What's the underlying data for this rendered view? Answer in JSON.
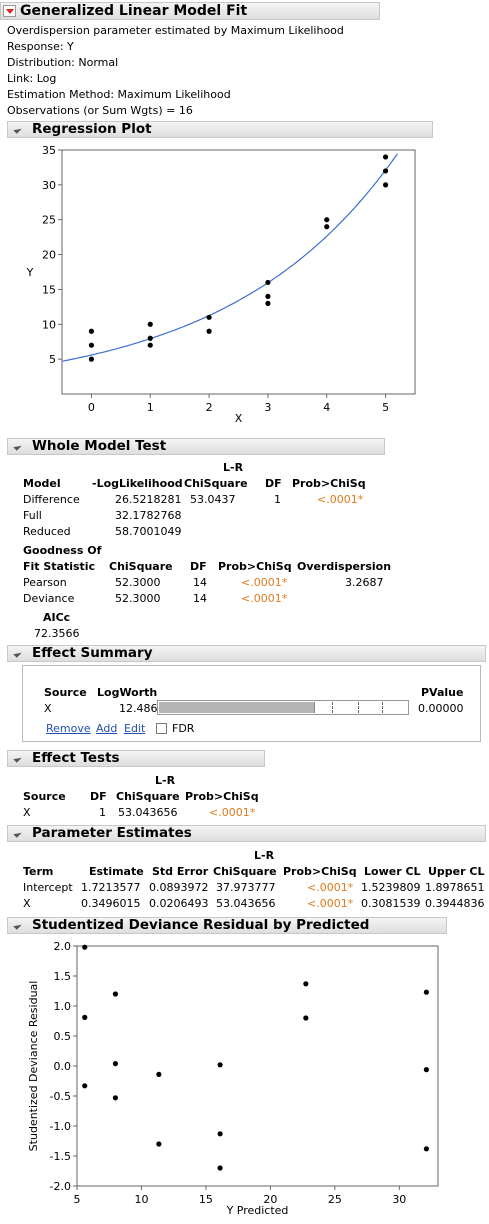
{
  "report": {
    "title": "Generalized Linear Model Fit",
    "info": [
      "Overdispersion parameter estimated by Maximum Likelihood",
      "Response: Y",
      "Distribution: Normal",
      "Link: Log",
      "Estimation Method: Maximum Likelihood",
      "Observations (or Sum Wgts) = 16"
    ]
  },
  "regression_plot": {
    "title": "Regression Plot",
    "chart_data": {
      "type": "scatter",
      "xlabel": "X",
      "ylabel": "Y",
      "xlim": [
        -0.5,
        5.5
      ],
      "ylim": [
        0,
        35
      ],
      "xticks": [
        "0",
        "1",
        "2",
        "3",
        "4",
        "5"
      ],
      "yticks": [
        "5",
        "10",
        "15",
        "20",
        "25",
        "30",
        "35"
      ],
      "points": [
        [
          0,
          5
        ],
        [
          0,
          7
        ],
        [
          0,
          9
        ],
        [
          1,
          7
        ],
        [
          1,
          8
        ],
        [
          1,
          10
        ],
        [
          2,
          9
        ],
        [
          2,
          11
        ],
        [
          3,
          13
        ],
        [
          3,
          14
        ],
        [
          3,
          16
        ],
        [
          4,
          24
        ],
        [
          4,
          25
        ],
        [
          5,
          30
        ],
        [
          5,
          32
        ],
        [
          5,
          34
        ]
      ],
      "fit_curve": {
        "intercept": 1.7213577,
        "slope": 0.3496015,
        "link": "log"
      },
      "colors": {
        "points": "#000000",
        "curve": "#3b6fd4"
      }
    }
  },
  "whole_model_test": {
    "title": "Whole Model Test",
    "headers": [
      "Model",
      "-LogLikelihood",
      "L-R",
      "ChiSquare",
      "DF",
      "Prob>ChiSq"
    ],
    "rows": [
      {
        "model": "Difference",
        "loglik": "26.5218281",
        "chisq": "53.0437",
        "df": "1",
        "prob": "<.0001*"
      },
      {
        "model": "Full",
        "loglik": "32.1782768"
      },
      {
        "model": "Reduced",
        "loglik": "58.7001049"
      }
    ],
    "gof_headers": [
      "Goodness Of",
      "Fit Statistic",
      "ChiSquare",
      "DF",
      "Prob>ChiSq",
      "Overdispersion"
    ],
    "gof_rows": [
      {
        "stat": "Pearson",
        "chisq": "52.3000",
        "df": "14",
        "prob": "<.0001*",
        "over": "3.2687"
      },
      {
        "stat": "Deviance",
        "chisq": "52.3000",
        "df": "14",
        "prob": "<.0001*"
      }
    ],
    "aicc_label": "AICc",
    "aicc_value": "72.3566"
  },
  "effect_summary": {
    "title": "Effect Summary",
    "headers": {
      "source": "Source",
      "logworth": "LogWorth",
      "pvalue": "PValue"
    },
    "row": {
      "source": "X",
      "logworth": "12.486",
      "pvalue": "0.00000",
      "bar_fraction": 0.62
    },
    "buttons": {
      "remove": "Remove",
      "add": "Add",
      "edit": "Edit"
    },
    "fdr_label": "FDR"
  },
  "effect_tests": {
    "title": "Effect Tests",
    "headers": [
      "Source",
      "DF",
      "L-R",
      "ChiSquare",
      "Prob>ChiSq"
    ],
    "row": {
      "source": "X",
      "df": "1",
      "chisq": "53.043656",
      "prob": "<.0001*"
    }
  },
  "parameter_estimates": {
    "title": "Parameter Estimates",
    "headers": [
      "Term",
      "Estimate",
      "Std Error",
      "L-R",
      "ChiSquare",
      "Prob>ChiSq",
      "Lower CL",
      "Upper CL"
    ],
    "rows": [
      {
        "term": "Intercept",
        "est": "1.7213577",
        "se": "0.0893972",
        "chisq": "37.973777",
        "prob": "<.0001*",
        "lcl": "1.5239809",
        "ucl": "1.8978651"
      },
      {
        "term": "X",
        "est": "0.3496015",
        "se": "0.0206493",
        "chisq": "53.043656",
        "prob": "<.0001*",
        "lcl": "0.3081539",
        "ucl": "0.3944836"
      }
    ]
  },
  "residual_plot": {
    "title": "Studentized Deviance Residual by Predicted",
    "chart_data": {
      "type": "scatter",
      "xlabel": "Y Predicted",
      "ylabel": "Studentized Deviance Residual",
      "xlim": [
        5,
        33
      ],
      "ylim": [
        -2.0,
        2.0
      ],
      "xticks": [
        "5",
        "10",
        "15",
        "20",
        "25",
        "30"
      ],
      "yticks": [
        "-2.0",
        "-1.5",
        "-1.0",
        "-0.5",
        "0.0",
        "0.5",
        "1.0",
        "1.5",
        "2.0"
      ],
      "points": [
        [
          5.6,
          1.98
        ],
        [
          5.6,
          0.81
        ],
        [
          5.6,
          -0.33
        ],
        [
          7.98,
          1.2
        ],
        [
          7.98,
          0.04
        ],
        [
          7.98,
          -0.53
        ],
        [
          11.35,
          -0.14
        ],
        [
          11.35,
          -1.3
        ],
        [
          16.1,
          0.02
        ],
        [
          16.1,
          -1.13
        ],
        [
          16.1,
          -1.7
        ],
        [
          22.75,
          1.37
        ],
        [
          22.75,
          0.8
        ],
        [
          32.1,
          1.23
        ],
        [
          32.1,
          -0.06
        ],
        [
          32.1,
          -1.38
        ]
      ],
      "colors": {
        "points": "#000000"
      }
    }
  }
}
